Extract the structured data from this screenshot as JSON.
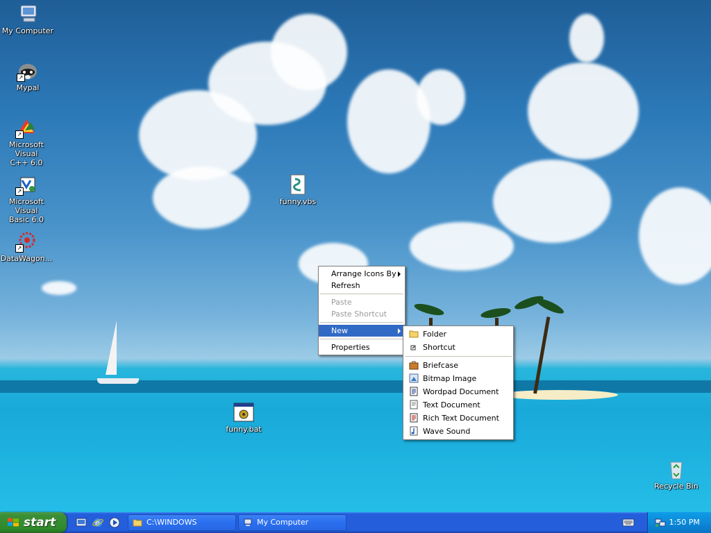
{
  "desktop": {
    "icons": [
      {
        "label": "My Computer",
        "icon": "my-computer-icon"
      },
      {
        "label": "Mypal",
        "icon": "raccoon-icon"
      },
      {
        "label_line1": "Microsoft Visual",
        "label_line2": "C++ 6.0",
        "icon": "visual-cpp-icon"
      },
      {
        "label_line1": "Microsoft Visual",
        "label_line2": "Basic 6.0",
        "icon": "visual-basic-icon"
      },
      {
        "label": "DataWagon...",
        "icon": "datawagon-icon"
      },
      {
        "label": "funny.vbs",
        "icon": "vbs-script-icon"
      },
      {
        "label": "funny.bat",
        "icon": "batch-file-icon"
      },
      {
        "label": "Recycle Bin",
        "icon": "recycle-bin-icon"
      }
    ]
  },
  "context_menu": {
    "items": [
      {
        "label": "Arrange Icons By",
        "has_submenu": true
      },
      {
        "label": "Refresh"
      },
      {
        "label": "Paste",
        "disabled": true
      },
      {
        "label": "Paste Shortcut",
        "disabled": true
      },
      {
        "label": "New",
        "has_submenu": true,
        "active": true
      },
      {
        "label": "Properties"
      }
    ]
  },
  "new_submenu": {
    "items": [
      {
        "label": "Folder",
        "icon": "folder-icon"
      },
      {
        "label": "Shortcut",
        "icon": "shortcut-icon"
      },
      {
        "label": "Briefcase",
        "icon": "briefcase-icon"
      },
      {
        "label": "Bitmap Image",
        "icon": "bitmap-icon"
      },
      {
        "label": "Wordpad Document",
        "icon": "wordpad-icon"
      },
      {
        "label": "Text Document",
        "icon": "text-document-icon"
      },
      {
        "label": "Rich Text Document",
        "icon": "rich-text-icon"
      },
      {
        "label": "Wave Sound",
        "icon": "wave-sound-icon"
      }
    ]
  },
  "taskbar": {
    "start_label": "start",
    "tasks": [
      {
        "label": "C:\\WINDOWS",
        "icon": "folder-icon"
      },
      {
        "label": "My Computer",
        "icon": "my-computer-icon"
      }
    ],
    "clock": "1:50 PM"
  },
  "colors": {
    "menu_highlight": "#316ac5",
    "taskbar_blue": "#245edb",
    "start_green": "#3c8f37"
  }
}
